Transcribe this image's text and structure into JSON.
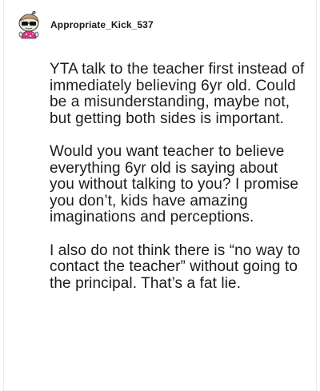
{
  "post": {
    "username": "Appropriate_Kick_537",
    "avatar_icon": "snoo-avatar-icon",
    "paragraphs": [
      "YTA talk to the teacher first instead of immediately believing 6yr old. Could be a misunderstanding, maybe not, but getting both sides is important.",
      "Would you want teacher to believe everything 6yr old is saying about you without talking to you? I promise you don’t, kids have amazing imaginations and perceptions.",
      "I also do not think there is “no way to contact the teacher” without going to the principal. That’s a fat lie."
    ]
  }
}
